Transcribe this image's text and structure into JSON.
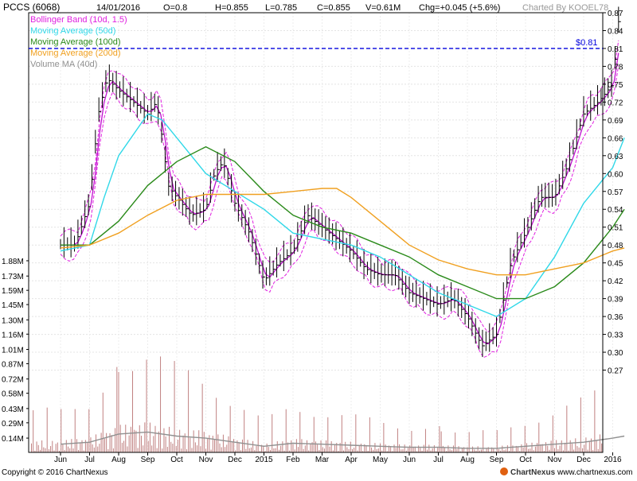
{
  "header": {
    "symbol": "PCCS (6068)",
    "date": "14/01/2016",
    "open": "O=0.8",
    "high": "H=0.855",
    "low": "L=0.785",
    "close": "C=0.855",
    "volume": "V=0.61M",
    "change": "Chg=+0.045 (+5.6%)",
    "charted_by": "Charted By KOOEL78"
  },
  "legend": [
    {
      "label": "Bollinger Band (10d, 1.5)",
      "color": "#e020e0"
    },
    {
      "label": "Moving Average (50d)",
      "color": "#30d8e8"
    },
    {
      "label": "Moving Average (100d)",
      "color": "#2a8a1a"
    },
    {
      "label": "Moving Average (200d)",
      "color": "#f0a020"
    },
    {
      "label": "Volume MA (40d)",
      "color": "#909090"
    }
  ],
  "footer": {
    "copyright": "Copyright © 2016 ChartNexus",
    "brand": "ChartNexus",
    "url": "www.chartnexus.com"
  },
  "chart_data": {
    "type": "line",
    "price_axis": {
      "ticks": [
        "0.27",
        "0.30",
        "0.33",
        "0.36",
        "0.39",
        "0.42",
        "0.45",
        "0.48",
        "0.51",
        "0.54",
        "0.57",
        "0.60",
        "0.63",
        "0.66",
        "0.69",
        "0.72",
        "0.75",
        "0.78",
        "0.81",
        "0.84",
        "0.87"
      ],
      "range": [
        0.24,
        0.87
      ]
    },
    "volume_axis": {
      "ticks": [
        "0.14M",
        "0.29M",
        "0.43M",
        "0.58M",
        "0.72M",
        "0.87M",
        "1.01M",
        "1.16M",
        "1.30M",
        "1.45M",
        "1.59M",
        "1.73M",
        "1.88M"
      ],
      "range": [
        0,
        1.95
      ]
    },
    "x_labels": [
      "Jun",
      "Jul",
      "Aug",
      "Sep",
      "Oct",
      "Nov",
      "Dec",
      "2015",
      "Feb",
      "Mar",
      "Apr",
      "May",
      "Jun",
      "Jul",
      "Aug",
      "Sep",
      "Oct",
      "Nov",
      "Dec",
      "2016"
    ],
    "reference_line": {
      "label": "$0.81",
      "value": 0.81
    },
    "series": [
      {
        "name": "Close",
        "color": "#000000",
        "points": [
          [
            0,
            0.48
          ],
          [
            0.5,
            0.48
          ],
          [
            1,
            0.55
          ],
          [
            1.3,
            0.7
          ],
          [
            1.6,
            0.76
          ],
          [
            2,
            0.74
          ],
          [
            2.5,
            0.72
          ],
          [
            3,
            0.7
          ],
          [
            3.3,
            0.72
          ],
          [
            3.5,
            0.66
          ],
          [
            3.7,
            0.58
          ],
          [
            4,
            0.56
          ],
          [
            4.5,
            0.53
          ],
          [
            5,
            0.54
          ],
          [
            5.3,
            0.6
          ],
          [
            5.6,
            0.62
          ],
          [
            6,
            0.55
          ],
          [
            6.5,
            0.5
          ],
          [
            7,
            0.42
          ],
          [
            7.5,
            0.45
          ],
          [
            8,
            0.47
          ],
          [
            8.5,
            0.53
          ],
          [
            9,
            0.51
          ],
          [
            9.5,
            0.49
          ],
          [
            10,
            0.47
          ],
          [
            10.5,
            0.44
          ],
          [
            11,
            0.43
          ],
          [
            11.5,
            0.43
          ],
          [
            12,
            0.4
          ],
          [
            12.5,
            0.39
          ],
          [
            13,
            0.38
          ],
          [
            13.5,
            0.39
          ],
          [
            14,
            0.36
          ],
          [
            14.5,
            0.31
          ],
          [
            15,
            0.33
          ],
          [
            15.5,
            0.45
          ],
          [
            16,
            0.5
          ],
          [
            16.5,
            0.56
          ],
          [
            17,
            0.56
          ],
          [
            17.5,
            0.62
          ],
          [
            18,
            0.7
          ],
          [
            18.5,
            0.72
          ],
          [
            19,
            0.75
          ],
          [
            19.2,
            0.855
          ]
        ]
      },
      {
        "name": "Moving Average (50d)",
        "color": "#30d8e8",
        "points": [
          [
            0,
            0.47
          ],
          [
            1,
            0.48
          ],
          [
            1.5,
            0.56
          ],
          [
            2,
            0.63
          ],
          [
            3,
            0.7
          ],
          [
            3.5,
            0.69
          ],
          [
            4,
            0.66
          ],
          [
            5,
            0.6
          ],
          [
            6,
            0.57
          ],
          [
            7,
            0.54
          ],
          [
            8,
            0.5
          ],
          [
            9,
            0.49
          ],
          [
            10,
            0.48
          ],
          [
            11,
            0.46
          ],
          [
            12,
            0.43
          ],
          [
            13,
            0.4
          ],
          [
            14,
            0.38
          ],
          [
            15,
            0.36
          ],
          [
            16,
            0.39
          ],
          [
            17,
            0.46
          ],
          [
            18,
            0.55
          ],
          [
            19,
            0.61
          ],
          [
            19.4,
            0.66
          ]
        ]
      },
      {
        "name": "Moving Average (100d)",
        "color": "#2a8a1a",
        "points": [
          [
            0,
            0.48
          ],
          [
            1,
            0.48
          ],
          [
            2,
            0.52
          ],
          [
            3,
            0.58
          ],
          [
            4,
            0.62
          ],
          [
            5,
            0.645
          ],
          [
            6,
            0.62
          ],
          [
            7,
            0.57
          ],
          [
            8,
            0.53
          ],
          [
            9,
            0.51
          ],
          [
            10,
            0.5
          ],
          [
            11,
            0.48
          ],
          [
            12,
            0.46
          ],
          [
            13,
            0.43
          ],
          [
            14,
            0.41
          ],
          [
            15,
            0.39
          ],
          [
            16,
            0.39
          ],
          [
            17,
            0.41
          ],
          [
            18,
            0.45
          ],
          [
            19,
            0.51
          ],
          [
            19.4,
            0.54
          ]
        ]
      },
      {
        "name": "Moving Average (200d)",
        "color": "#f0a020",
        "points": [
          [
            0,
            0.475
          ],
          [
            1,
            0.48
          ],
          [
            2,
            0.5
          ],
          [
            3,
            0.53
          ],
          [
            4,
            0.555
          ],
          [
            5,
            0.565
          ],
          [
            6,
            0.565
          ],
          [
            7,
            0.565
          ],
          [
            8,
            0.57
          ],
          [
            9,
            0.575
          ],
          [
            9.5,
            0.575
          ],
          [
            10,
            0.56
          ],
          [
            11,
            0.52
          ],
          [
            12,
            0.48
          ],
          [
            13,
            0.455
          ],
          [
            14,
            0.44
          ],
          [
            15,
            0.43
          ],
          [
            16,
            0.43
          ],
          [
            17,
            0.44
          ],
          [
            18,
            0.45
          ],
          [
            19,
            0.47
          ],
          [
            19.4,
            0.475
          ]
        ]
      },
      {
        "name": "Volume MA (40d)",
        "color": "#909090",
        "axis": "volume",
        "points": [
          [
            0,
            0.08
          ],
          [
            1,
            0.1
          ],
          [
            2,
            0.18
          ],
          [
            3,
            0.2
          ],
          [
            4,
            0.16
          ],
          [
            5,
            0.14
          ],
          [
            6,
            0.1
          ],
          [
            7,
            0.06
          ],
          [
            8,
            0.09
          ],
          [
            9,
            0.08
          ],
          [
            10,
            0.07
          ],
          [
            11,
            0.06
          ],
          [
            12,
            0.05
          ],
          [
            13,
            0.05
          ],
          [
            14,
            0.04
          ],
          [
            15,
            0.04
          ],
          [
            16,
            0.06
          ],
          [
            17,
            0.08
          ],
          [
            18,
            0.1
          ],
          [
            19,
            0.14
          ],
          [
            19.4,
            0.16
          ]
        ]
      }
    ]
  }
}
